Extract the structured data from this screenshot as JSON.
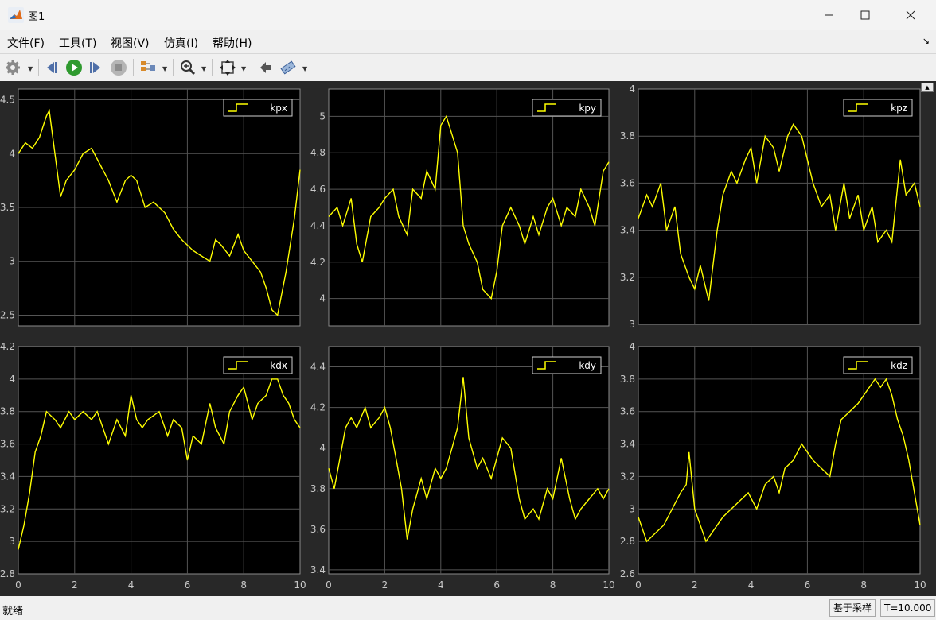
{
  "window": {
    "title": "图1",
    "minimize_icon": "minimize-icon",
    "maximize_icon": "maximize-icon",
    "close_icon": "close-icon"
  },
  "menu": [
    {
      "label": "文件(F)"
    },
    {
      "label": "工具(T)"
    },
    {
      "label": "视图(V)"
    },
    {
      "label": "仿真(I)"
    },
    {
      "label": "帮助(H)"
    }
  ],
  "toolbar": {
    "icons": [
      "gear-icon",
      "step-back-icon",
      "run-icon",
      "step-forward-icon",
      "stop-icon",
      "signal-selector-icon",
      "zoom-icon",
      "autoscale-icon",
      "highlight-block-icon",
      "measurements-icon"
    ]
  },
  "status": {
    "left": "就绪",
    "mode": "基于采样",
    "time": "T=10.000"
  },
  "colors": {
    "trace": "#ffff00",
    "axes_background": "#000000",
    "figure_background": "#282828",
    "grid": "#555555"
  },
  "chart_data": [
    {
      "type": "line",
      "series": [
        {
          "name": "kpx",
          "x": [
            0,
            0.25,
            0.5,
            0.75,
            1,
            1.1,
            1.3,
            1.5,
            1.7,
            2,
            2.3,
            2.6,
            2.8,
            3,
            3.2,
            3.5,
            3.8,
            4,
            4.2,
            4.5,
            4.8,
            5,
            5.2,
            5.5,
            5.8,
            6,
            6.2,
            6.5,
            6.8,
            7,
            7.2,
            7.5,
            7.8,
            8,
            8.3,
            8.6,
            8.8,
            9,
            9.2,
            9.5,
            9.8,
            10
          ],
          "y": [
            4.0,
            4.1,
            4.05,
            4.15,
            4.35,
            4.4,
            4.0,
            3.6,
            3.75,
            3.85,
            4.0,
            4.05,
            3.95,
            3.85,
            3.75,
            3.55,
            3.75,
            3.8,
            3.75,
            3.5,
            3.55,
            3.5,
            3.45,
            3.3,
            3.2,
            3.15,
            3.1,
            3.05,
            3.0,
            3.2,
            3.15,
            3.05,
            3.25,
            3.1,
            3.0,
            2.9,
            2.75,
            2.55,
            2.5,
            2.9,
            3.4,
            3.85
          ]
        }
      ],
      "xlim": [
        0,
        10
      ],
      "ylim": [
        2.4,
        4.6
      ],
      "xticks": [],
      "yticks": [
        2.5,
        3,
        3.5,
        4,
        4.5
      ],
      "legend": "top-right",
      "grid": true
    },
    {
      "type": "line",
      "series": [
        {
          "name": "kpy",
          "x": [
            0,
            0.3,
            0.5,
            0.8,
            1,
            1.2,
            1.5,
            1.8,
            2,
            2.3,
            2.5,
            2.8,
            3,
            3.3,
            3.5,
            3.8,
            4,
            4.2,
            4.4,
            4.6,
            4.8,
            5,
            5.3,
            5.5,
            5.8,
            6,
            6.2,
            6.5,
            6.8,
            7,
            7.3,
            7.5,
            7.8,
            8,
            8.3,
            8.5,
            8.8,
            9,
            9.3,
            9.5,
            9.8,
            10
          ],
          "y": [
            4.45,
            4.5,
            4.4,
            4.55,
            4.3,
            4.2,
            4.45,
            4.5,
            4.55,
            4.6,
            4.45,
            4.35,
            4.6,
            4.55,
            4.7,
            4.6,
            4.95,
            5.0,
            4.9,
            4.8,
            4.4,
            4.3,
            4.2,
            4.05,
            4.0,
            4.15,
            4.4,
            4.5,
            4.4,
            4.3,
            4.45,
            4.35,
            4.5,
            4.55,
            4.4,
            4.5,
            4.45,
            4.6,
            4.5,
            4.4,
            4.7,
            4.75
          ]
        }
      ],
      "xlim": [
        0,
        10
      ],
      "ylim": [
        3.85,
        5.15
      ],
      "xticks": [],
      "yticks": [
        4,
        4.2,
        4.4,
        4.6,
        4.8,
        5
      ],
      "legend": "top-right",
      "grid": true
    },
    {
      "type": "line",
      "series": [
        {
          "name": "kpz",
          "x": [
            0,
            0.3,
            0.5,
            0.8,
            1,
            1.3,
            1.5,
            1.8,
            2,
            2.2,
            2.5,
            2.8,
            3,
            3.3,
            3.5,
            3.8,
            4,
            4.2,
            4.5,
            4.8,
            5,
            5.3,
            5.5,
            5.8,
            6,
            6.2,
            6.5,
            6.8,
            7,
            7.3,
            7.5,
            7.8,
            8,
            8.3,
            8.5,
            8.8,
            9,
            9.3,
            9.5,
            9.8,
            10
          ],
          "y": [
            3.45,
            3.55,
            3.5,
            3.6,
            3.4,
            3.5,
            3.3,
            3.2,
            3.15,
            3.25,
            3.1,
            3.4,
            3.55,
            3.65,
            3.6,
            3.7,
            3.75,
            3.6,
            3.8,
            3.75,
            3.65,
            3.8,
            3.85,
            3.8,
            3.7,
            3.6,
            3.5,
            3.55,
            3.4,
            3.6,
            3.45,
            3.55,
            3.4,
            3.5,
            3.35,
            3.4,
            3.35,
            3.7,
            3.55,
            3.6,
            3.5
          ]
        }
      ],
      "xlim": [
        0,
        10
      ],
      "ylim": [
        3,
        4
      ],
      "xticks": [],
      "yticks": [
        3,
        3.2,
        3.4,
        3.6,
        3.8,
        4
      ],
      "legend": "top-right",
      "grid": true
    },
    {
      "type": "line",
      "series": [
        {
          "name": "kdx",
          "x": [
            0,
            0.2,
            0.4,
            0.6,
            0.8,
            1,
            1.3,
            1.5,
            1.8,
            2,
            2.3,
            2.6,
            2.8,
            3,
            3.2,
            3.5,
            3.8,
            4,
            4.2,
            4.4,
            4.6,
            5,
            5.3,
            5.5,
            5.8,
            6,
            6.2,
            6.5,
            6.8,
            7,
            7.3,
            7.5,
            7.8,
            8,
            8.3,
            8.5,
            8.8,
            9,
            9.2,
            9.4,
            9.6,
            9.8,
            10
          ],
          "y": [
            2.95,
            3.1,
            3.3,
            3.55,
            3.65,
            3.8,
            3.75,
            3.7,
            3.8,
            3.75,
            3.8,
            3.75,
            3.8,
            3.7,
            3.6,
            3.75,
            3.65,
            3.9,
            3.75,
            3.7,
            3.75,
            3.8,
            3.65,
            3.75,
            3.7,
            3.5,
            3.65,
            3.6,
            3.85,
            3.7,
            3.6,
            3.8,
            3.9,
            3.95,
            3.75,
            3.85,
            3.9,
            4.0,
            4.0,
            3.9,
            3.85,
            3.75,
            3.7
          ]
        }
      ],
      "xlim": [
        0,
        10
      ],
      "ylim": [
        2.8,
        4.2
      ],
      "xticks": [
        0,
        2,
        4,
        6,
        8,
        10
      ],
      "yticks": [
        2.8,
        3,
        3.2,
        3.4,
        3.6,
        3.8,
        4,
        4.2
      ],
      "legend": "top-right",
      "grid": true
    },
    {
      "type": "line",
      "series": [
        {
          "name": "kdy",
          "x": [
            0,
            0.2,
            0.4,
            0.6,
            0.8,
            1,
            1.3,
            1.5,
            1.8,
            2,
            2.2,
            2.4,
            2.6,
            2.8,
            3,
            3.3,
            3.5,
            3.8,
            4,
            4.2,
            4.4,
            4.6,
            4.8,
            5,
            5.3,
            5.5,
            5.8,
            6,
            6.2,
            6.5,
            6.8,
            7,
            7.3,
            7.5,
            7.8,
            8,
            8.3,
            8.6,
            8.8,
            9,
            9.3,
            9.6,
            9.8,
            10
          ],
          "y": [
            3.9,
            3.8,
            3.95,
            4.1,
            4.15,
            4.1,
            4.2,
            4.1,
            4.15,
            4.2,
            4.1,
            3.95,
            3.8,
            3.55,
            3.7,
            3.85,
            3.75,
            3.9,
            3.85,
            3.9,
            4.0,
            4.1,
            4.35,
            4.05,
            3.9,
            3.95,
            3.85,
            3.95,
            4.05,
            4.0,
            3.75,
            3.65,
            3.7,
            3.65,
            3.8,
            3.75,
            3.95,
            3.75,
            3.65,
            3.7,
            3.75,
            3.8,
            3.75,
            3.8
          ]
        }
      ],
      "xlim": [
        0,
        10
      ],
      "ylim": [
        3.38,
        4.5
      ],
      "xticks": [
        0,
        2,
        4,
        6,
        8,
        10
      ],
      "yticks": [
        3.4,
        3.6,
        3.8,
        4,
        4.2,
        4.4
      ],
      "legend": "top-right",
      "grid": true
    },
    {
      "type": "line",
      "series": [
        {
          "name": "kdz",
          "x": [
            0,
            0.3,
            0.6,
            0.9,
            1.2,
            1.5,
            1.7,
            1.8,
            2,
            2.2,
            2.4,
            2.6,
            2.8,
            3,
            3.3,
            3.6,
            3.9,
            4.2,
            4.5,
            4.8,
            5,
            5.2,
            5.5,
            5.8,
            6,
            6.2,
            6.5,
            6.8,
            7,
            7.2,
            7.5,
            7.8,
            8,
            8.2,
            8.4,
            8.6,
            8.8,
            9,
            9.2,
            9.4,
            9.6,
            9.8,
            10
          ],
          "y": [
            2.95,
            2.8,
            2.85,
            2.9,
            3.0,
            3.1,
            3.15,
            3.35,
            3.0,
            2.9,
            2.8,
            2.85,
            2.9,
            2.95,
            3.0,
            3.05,
            3.1,
            3.0,
            3.15,
            3.2,
            3.1,
            3.25,
            3.3,
            3.4,
            3.35,
            3.3,
            3.25,
            3.2,
            3.4,
            3.55,
            3.6,
            3.65,
            3.7,
            3.75,
            3.8,
            3.75,
            3.8,
            3.7,
            3.55,
            3.45,
            3.3,
            3.1,
            2.9
          ]
        }
      ],
      "xlim": [
        0,
        10
      ],
      "ylim": [
        2.6,
        4
      ],
      "xticks": [
        0,
        2,
        4,
        6,
        8,
        10
      ],
      "yticks": [
        2.6,
        2.8,
        3,
        3.2,
        3.4,
        3.6,
        3.8,
        4
      ],
      "legend": "top-right",
      "grid": true
    }
  ]
}
